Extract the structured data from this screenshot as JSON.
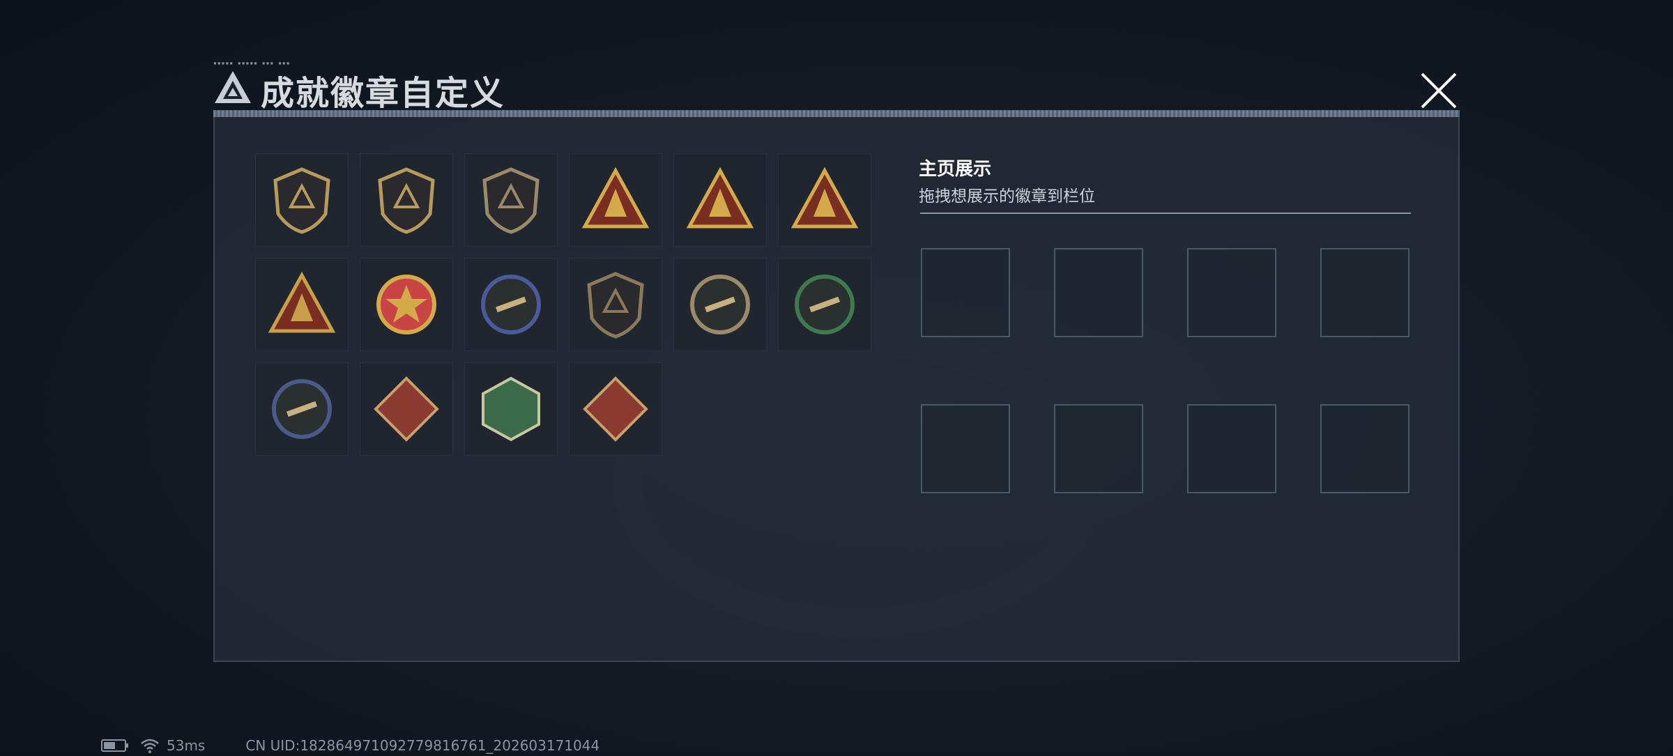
{
  "dialog": {
    "title": "成就徽章自定义",
    "tiny_caption": "▪▪▪▪▪ ▪▪▪▪▪ ▪▪▪ ▪▪▪"
  },
  "badges": [
    {
      "name": "triangle-logo-shield-badge",
      "color": "#b89a5a"
    },
    {
      "name": "helicopter-shield-badge",
      "color": "#b89a5a"
    },
    {
      "name": "diamond-emblem-shield-badge",
      "color": "#9a8a6a"
    },
    {
      "name": "level-55-triangle-badge",
      "color": "#d4aa4a"
    },
    {
      "name": "helmet-triangle-badge",
      "color": "#d4aa4a"
    },
    {
      "name": "number-1-triangle-badge",
      "color": "#d4aa4a"
    },
    {
      "name": "soldiers-triangle-badge",
      "color": "#c8a04a"
    },
    {
      "name": "star-medal-badge",
      "color": "#c94444"
    },
    {
      "name": "blue-crest-badge",
      "color": "#4a5a9a"
    },
    {
      "name": "gem-shield-badge",
      "color": "#8a7a5a"
    },
    {
      "name": "rifle-round-badge",
      "color": "#9a8a6a"
    },
    {
      "name": "green-crosshair-badge",
      "color": "#3e7a4e"
    },
    {
      "name": "blue-gold-wreath-badge",
      "color": "#4a5a8a"
    },
    {
      "name": "wolf-diamond-badge",
      "color": "#8a3a2e"
    },
    {
      "name": "snake-hexagon-badge",
      "color": "#3a6a4a"
    },
    {
      "name": "dragon-diamond-badge",
      "color": "#8a3a2e"
    }
  ],
  "showcase": {
    "title": "主页展示",
    "subtitle": "拖拽想展示的徽章到栏位",
    "slot_count": 8
  },
  "status": {
    "ping": "53ms",
    "uid": "CN UID:18286497109277981676‌1_202603171044"
  }
}
